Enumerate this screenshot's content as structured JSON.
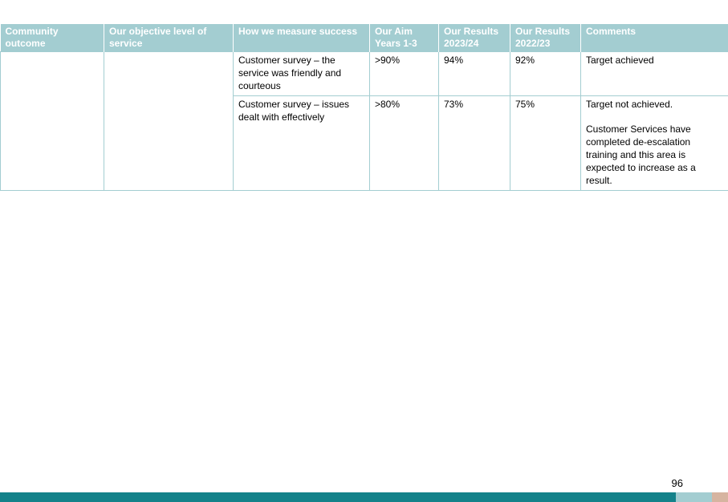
{
  "table": {
    "headers": [
      "Community outcome",
      "Our objective level of service",
      "How we measure success",
      "Our Aim Years 1-3",
      "Our Results 2023/24",
      "Our Results 2022/23",
      "Comments"
    ],
    "rows": [
      {
        "outcome": "",
        "objective": "",
        "measure": "Customer survey – the service was friendly and courteous",
        "aim": ">90%",
        "result_2023_24": "94%",
        "result_2022_23": "92%",
        "comments": [
          "Target achieved"
        ]
      },
      {
        "outcome": "",
        "objective": "",
        "measure": "Customer survey – issues dealt with effectively",
        "aim": ">80%",
        "result_2023_24": "73%",
        "result_2022_23": "75%",
        "comments": [
          "Target not achieved.",
          "Customer Services have completed de-escalation training and this area is expected to increase as a result."
        ]
      }
    ]
  },
  "footer": {
    "page_number": "96"
  },
  "colors": {
    "header_bg": "#a3cdd1",
    "footer_main": "#14828a",
    "footer_light": "#a3cdd1",
    "footer_accent": "#d6b4a0"
  }
}
